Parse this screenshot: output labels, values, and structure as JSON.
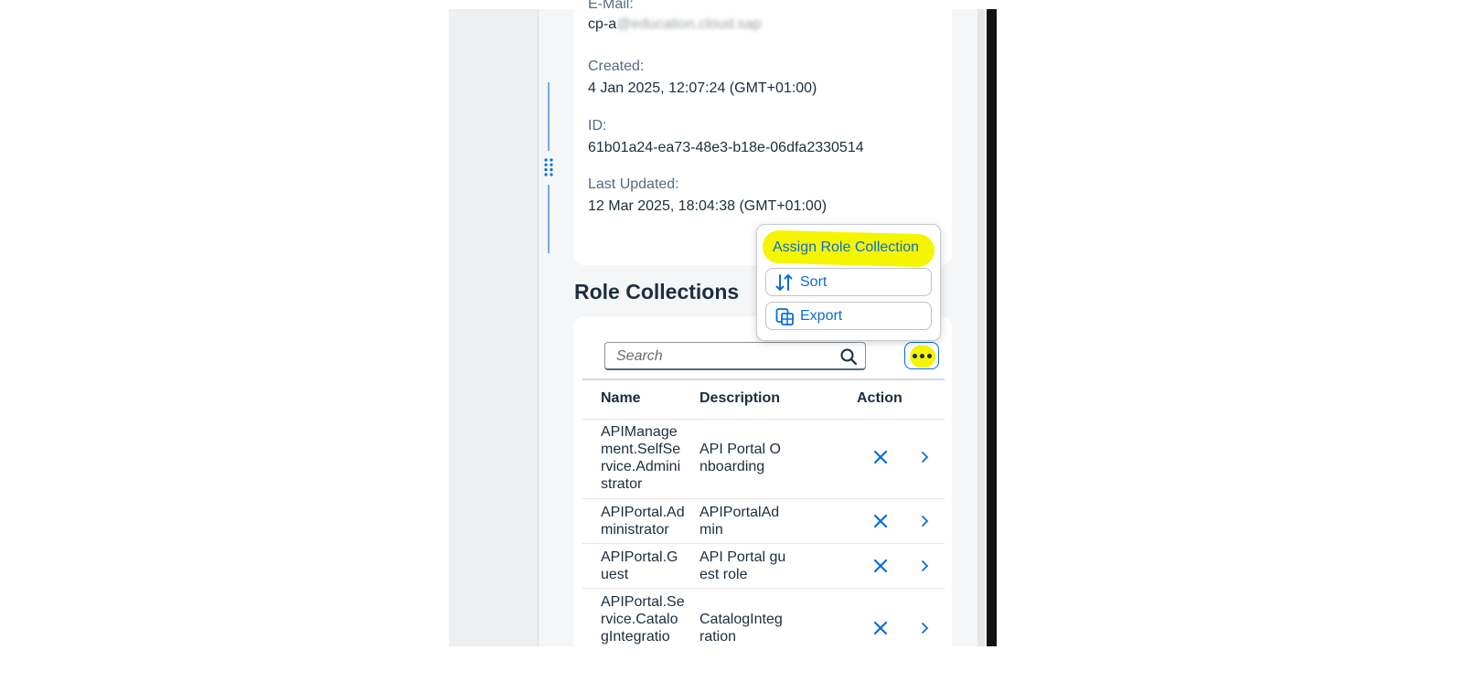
{
  "details": {
    "email_label": "E-Mail:",
    "email_value_visible": "cp-a",
    "email_value_blurred": "@education.cloud.sap",
    "created_label": "Created:",
    "created_value": "4 Jan 2025, 12:07:24 (GMT+01:00)",
    "id_label": "ID:",
    "id_value": "61b01a24-ea73-48e3-b18e-06dfa2330514",
    "updated_label": "Last Updated:",
    "updated_value": "12 Mar 2025, 18:04:38 (GMT+01:00)"
  },
  "section": {
    "title": "Role Collections"
  },
  "search": {
    "placeholder": "Search"
  },
  "popover": {
    "items": [
      {
        "label": "Assign Role Collection",
        "icon": "none",
        "highlighted": true
      },
      {
        "label": "Sort",
        "icon": "sort-icon"
      },
      {
        "label": "Export",
        "icon": "export-icon"
      }
    ]
  },
  "table": {
    "columns": [
      "Name",
      "Description",
      "Action"
    ],
    "rows": [
      {
        "name": "APIManagement.SelfService.Administrator",
        "description": "API Portal Onboarding"
      },
      {
        "name": "APIPortal.Administrator",
        "description": "APIPortalAdmin"
      },
      {
        "name": "APIPortal.Guest",
        "description": "API Portal guest role"
      },
      {
        "name": "APIPortal.Service.CatalogIntegratio",
        "description": "CatalogIntegration"
      }
    ]
  },
  "colors": {
    "accent": "#0a6ed1",
    "highlight": "#f5f500",
    "text": "#1d2d3e",
    "label": "#556b82"
  }
}
